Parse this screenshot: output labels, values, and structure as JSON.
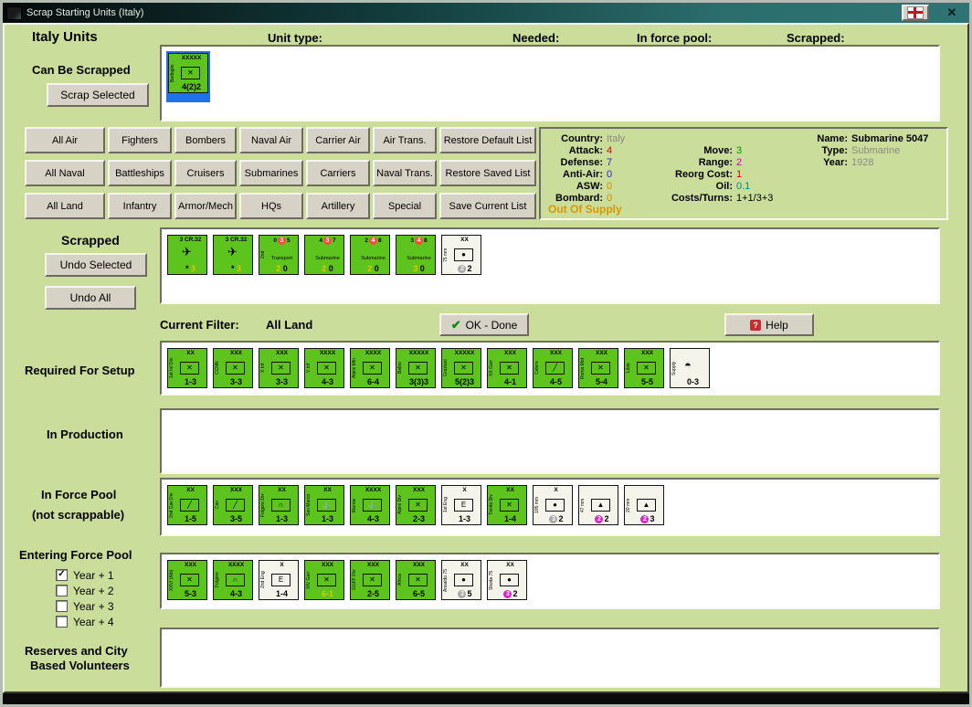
{
  "window": {
    "title": "Scrap Starting Units (Italy)"
  },
  "header": {
    "italy_units": "Italy Units",
    "unit_type": "Unit type:",
    "needed": "Needed:",
    "in_force_pool": "In force pool:",
    "scrapped": "Scrapped:"
  },
  "can_be_scrapped": {
    "label": "Can Be Scrapped",
    "scrap_button": "Scrap Selected",
    "counters": [
      {
        "vert": "Badoglio",
        "top": "XXXXX",
        "sym": "inf",
        "stats": "4(2)2",
        "selected": true
      }
    ]
  },
  "filter_buttons": [
    [
      "All Air",
      "Fighters",
      "Bombers",
      "Naval Air",
      "Carrier Air",
      "Air Trans.",
      "Restore Default List"
    ],
    [
      "All Naval",
      "Battleships",
      "Cruisers",
      "Submarines",
      "Carriers",
      "Naval Trans.",
      "Restore Saved List"
    ],
    [
      "All Land",
      "Infantry",
      "Armor/Mech",
      "HQs",
      "Artillery",
      "Special",
      "Save Current List"
    ]
  ],
  "info": {
    "left": [
      {
        "label": "Country:",
        "value": "Italy",
        "color": "gray"
      },
      {
        "label": "Attack:",
        "value": "4",
        "color": "red"
      },
      {
        "label": "Defense:",
        "value": "7",
        "color": "blue"
      },
      {
        "label": "Anti-Air:",
        "value": "0",
        "color": "blue"
      },
      {
        "label": "ASW:",
        "value": "0",
        "color": "orange"
      },
      {
        "label": "Bombard:",
        "value": "0",
        "color": "orange"
      }
    ],
    "mid": [
      {
        "label": "Move:",
        "value": "3",
        "color": "green"
      },
      {
        "label": "Range:",
        "value": "2",
        "color": "magenta"
      },
      {
        "label": "Reorg Cost:",
        "value": "1",
        "color": "red"
      },
      {
        "label": "Oil:",
        "value": "0.1",
        "color": "teal"
      },
      {
        "label": "Costs/Turns:",
        "value": "1+1/3+3",
        "color": "black"
      }
    ],
    "right": [
      {
        "label": "Name:",
        "value": "Submarine 5047",
        "color": "black",
        "bold": true
      },
      {
        "label": "Type:",
        "value": "Submarine",
        "color": "gray"
      },
      {
        "label": "Year:",
        "value": "1928",
        "color": "gray"
      }
    ],
    "out_of_supply": "Out Of Supply"
  },
  "scrapped": {
    "label": "Scrapped",
    "undo_selected": "Undo Selected",
    "undo_all": "Undo All",
    "counters": [
      {
        "vert": "",
        "top": "3  CR.32",
        "sym": "air",
        "statsParts": [
          {
            "t": "*  "
          },
          {
            "t": "3",
            "color": "#e0c800"
          }
        ]
      },
      {
        "vert": "",
        "top": "3  CR.32",
        "sym": "air",
        "statsParts": [
          {
            "t": "*  "
          },
          {
            "t": "3",
            "color": "#e0c800"
          }
        ]
      },
      {
        "vert": "2nd",
        "topParts": [
          {
            "t": "0"
          },
          {
            "t": "3",
            "badge": "#ff4a3a"
          },
          {
            "t": "5"
          }
        ],
        "mid": "Transport",
        "statsParts": [
          {
            "t": "2",
            "color": "#e0c800"
          },
          {
            "t": " 0"
          }
        ]
      },
      {
        "vert": "",
        "topParts": [
          {
            "t": "4"
          },
          {
            "t": "3",
            "badge": "#ff4a3a"
          },
          {
            "t": "7"
          }
        ],
        "mid": "Submarine",
        "statsParts": [
          {
            "t": "2",
            "color": "#e0c800"
          },
          {
            "t": " 0"
          }
        ]
      },
      {
        "vert": "",
        "topParts": [
          {
            "t": "2"
          },
          {
            "t": "4",
            "badge": "#ff4a3a"
          },
          {
            "t": "8"
          }
        ],
        "mid": "Submarine",
        "statsParts": [
          {
            "t": "2",
            "color": "#e0c800"
          },
          {
            "t": " 0"
          }
        ]
      },
      {
        "vert": "",
        "topParts": [
          {
            "t": "3"
          },
          {
            "t": "4",
            "badge": "#ff4a3a"
          },
          {
            "t": "8"
          }
        ],
        "mid": "Submarine",
        "statsParts": [
          {
            "t": "3",
            "color": "#e0c800"
          },
          {
            "t": " 0"
          }
        ]
      },
      {
        "vert": "75 mm",
        "top": "XX",
        "sym": "art",
        "light": true,
        "statsParts": [
          {
            "t": "2",
            "badge": "#a8a8a8"
          },
          {
            "t": "2"
          }
        ]
      }
    ]
  },
  "filter_bar": {
    "current_filter_label": "Current Filter:",
    "current_filter_value": "All Land",
    "ok_button": "OK - Done",
    "help_button": "Help"
  },
  "required_for_setup": {
    "label": "Required For Setup",
    "counters": [
      {
        "vert": "1st Inf Div",
        "top": "XX",
        "sym": "inf",
        "stats": "1-3"
      },
      {
        "vert": "CCNN",
        "top": "XXX",
        "sym": "inf",
        "stats": "3-3"
      },
      {
        "vert": "X Inf",
        "top": "XXX",
        "sym": "inf",
        "stats": "3-3"
      },
      {
        "vert": "V Inf",
        "top": "XXXX",
        "sym": "inf",
        "stats": "4-3"
      },
      {
        "vert": "Alpini Mtn",
        "top": "XXXX",
        "sym": "mtn",
        "stats": "6-4"
      },
      {
        "vert": "Balbo",
        "top": "XXXXX",
        "sym": "inf",
        "stats": "3(3)3"
      },
      {
        "vert": "Graziani",
        "top": "XXXXX",
        "sym": "inf",
        "stats": "5(2)3"
      },
      {
        "vert": "XX Garr",
        "top": "XXX",
        "sym": "inf",
        "stats": "4-1"
      },
      {
        "vert": "Celere",
        "top": "XXX",
        "sym": "cav",
        "stats": "4-5"
      },
      {
        "vert": "Roma Mot",
        "top": "XXX",
        "sym": "inf",
        "stats": "5-4"
      },
      {
        "vert": "Libia",
        "top": "XXX",
        "sym": "inf",
        "stats": "5-5"
      },
      {
        "vert": "Supply",
        "top": "",
        "sym": "supply",
        "stats": "0-3",
        "light": true
      }
    ]
  },
  "in_production": {
    "label": "In Production",
    "counters": []
  },
  "in_force_pool": {
    "label": "In Force Pool",
    "sublabel": "(not scrappable)",
    "counters": [
      {
        "vert": "2nd Cav Div",
        "top": "XX",
        "sym": "cav",
        "stats": "1-5"
      },
      {
        "vert": "Cav",
        "top": "XXX",
        "sym": "cav",
        "stats": "3-5"
      },
      {
        "vert": "Folgore Div",
        "top": "XX",
        "sym": "para",
        "stats": "1-3"
      },
      {
        "vert": "San Marco",
        "top": "XX",
        "sym": "marine",
        "stats": "1-3"
      },
      {
        "vert": "Marine",
        "top": "XXXX",
        "sym": "marine",
        "stats": "4-3"
      },
      {
        "vert": "Alpini Div",
        "top": "XXX",
        "sym": "mtn",
        "stats": "2-3"
      },
      {
        "vert": "1st Eng",
        "top": "X",
        "sym": "eng",
        "stats": "1-3",
        "light": true
      },
      {
        "vert": "Trento Div",
        "top": "XX",
        "sym": "inf",
        "stats": "1-4"
      },
      {
        "vert": "105 mm",
        "top": "X",
        "sym": "art",
        "light": true,
        "statsParts": [
          {
            "t": "3",
            "badge": "#a8a8a8"
          },
          {
            "t": "2"
          }
        ]
      },
      {
        "vert": "47 mm",
        "top": "",
        "sym": "at",
        "light": true,
        "statsParts": [
          {
            "t": "2",
            "badge": "#e020c8"
          },
          {
            "t": "2"
          }
        ]
      },
      {
        "vert": "20 mm",
        "top": "",
        "sym": "aa",
        "light": true,
        "statsParts": [
          {
            "t": "2",
            "badge": "#e020c8"
          },
          {
            "t": "3"
          }
        ]
      }
    ]
  },
  "entering_force_pool": {
    "label": "Entering Force Pool",
    "checkboxes": [
      {
        "label": "Year + 1",
        "checked": true
      },
      {
        "label": "Year + 2",
        "checked": false
      },
      {
        "label": "Year + 3",
        "checked": false
      },
      {
        "label": "Year + 4",
        "checked": false
      }
    ],
    "counters": [
      {
        "vert": "XXVI (Alb)",
        "top": "XXX",
        "sym": "inf",
        "stats": "5-3"
      },
      {
        "vert": "Folgore",
        "top": "XXXX",
        "sym": "para",
        "stats": "4-3"
      },
      {
        "vert": "2nd Eng",
        "top": "X",
        "sym": "eng",
        "stats": "1-4",
        "light": true
      },
      {
        "vert": "XIV Garr",
        "top": "XXX",
        "sym": "inf",
        "stats": "6-1",
        "statsColor": "#e0c800"
      },
      {
        "vert": "GGFF Div",
        "top": "XXX",
        "sym": "inf",
        "stats": "2-5"
      },
      {
        "vert": "Africa",
        "top": "XXX",
        "sym": "inf",
        "stats": "6-5"
      },
      {
        "vert": "Ansaldo 75",
        "top": "XX",
        "sym": "art",
        "light": true,
        "statsParts": [
          {
            "t": "3",
            "badge": "#a8a8a8"
          },
          {
            "t": "5"
          }
        ]
      },
      {
        "vert": "Skoda 75",
        "top": "XX",
        "sym": "art",
        "light": true,
        "statsParts": [
          {
            "t": "3",
            "badge": "#e020c8"
          },
          {
            "t": "2"
          }
        ]
      }
    ]
  },
  "reserves": {
    "label_line1": "Reserves and City",
    "label_line2": "Based Volunteers",
    "counters": []
  }
}
